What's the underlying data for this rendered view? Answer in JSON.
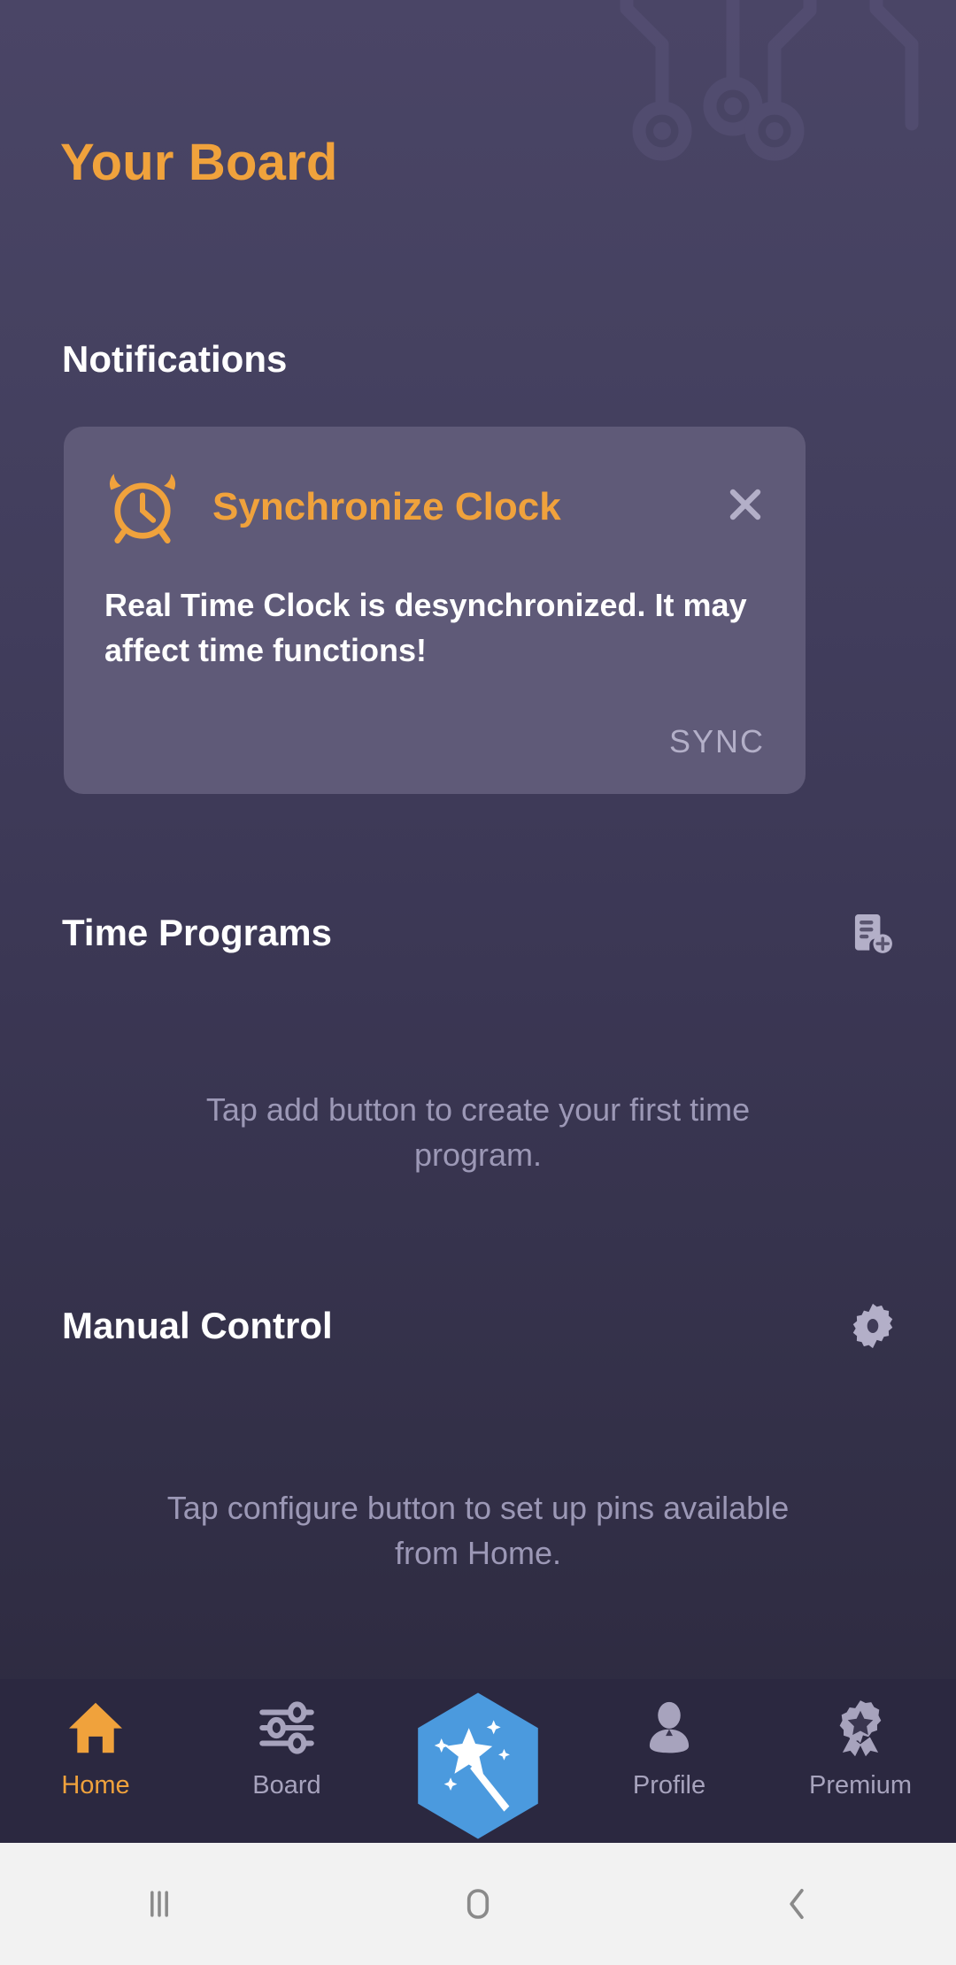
{
  "header": {
    "title": "Your Board"
  },
  "sections": {
    "notifications": {
      "heading": "Notifications"
    },
    "time_programs": {
      "heading": "Time Programs",
      "action_icon": "add-note-icon",
      "empty_text": "Tap add button to create your first time program."
    },
    "manual_control": {
      "heading": "Manual Control",
      "action_icon": "gear-icon",
      "empty_text": "Tap configure button to set up pins available from Home."
    }
  },
  "notification_card": {
    "icon": "alarm-clock-icon",
    "title": "Synchronize Clock",
    "body": "Real Time Clock is desynchronized. It may affect time functions!",
    "action_label": "SYNC",
    "close_icon": "close-icon"
  },
  "bottom_nav": {
    "items": [
      {
        "label": "Home",
        "icon": "home-icon",
        "active": true
      },
      {
        "label": "Board",
        "icon": "sliders-icon",
        "active": false
      },
      {
        "label": "Profile",
        "icon": "person-icon",
        "active": false
      },
      {
        "label": "Premium",
        "icon": "award-icon",
        "active": false
      }
    ],
    "center_button": {
      "icon": "magic-wand-icon",
      "shape": "hexagon"
    }
  },
  "system_bar": {
    "recents_icon": "recents-icon",
    "home_icon": "home-square-icon",
    "back_icon": "back-chevron-icon"
  },
  "colors": {
    "accent": "#f0a23c",
    "card": "#5f5a78",
    "muted": "#9c98b6",
    "hex": "#4b9ade",
    "bg_top": "#4a4566",
    "bg_bottom": "#2c2a3e"
  }
}
